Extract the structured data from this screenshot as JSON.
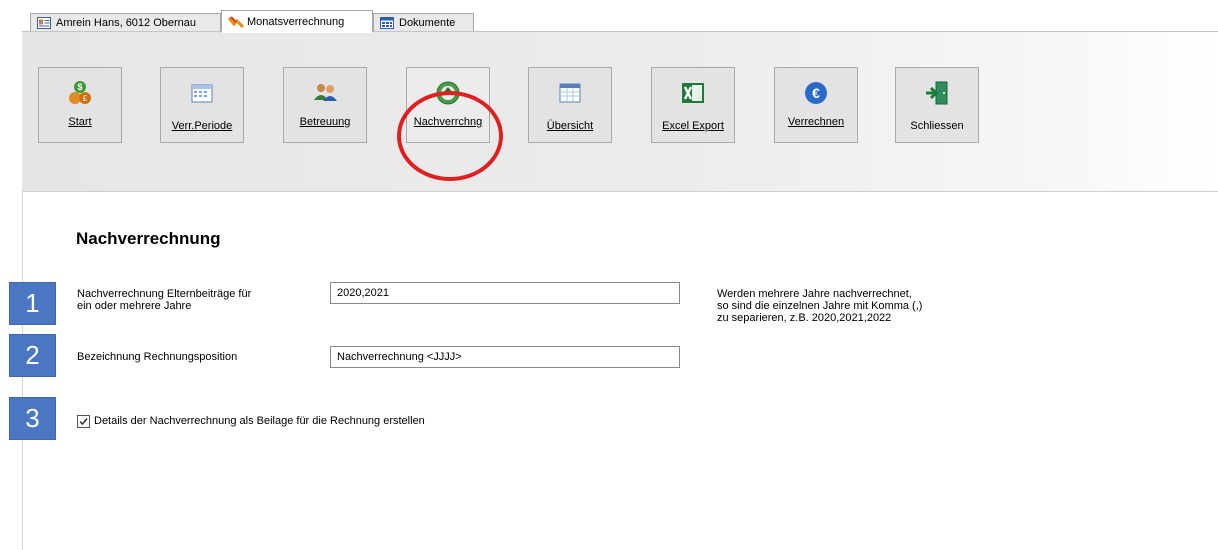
{
  "tabs": [
    {
      "label": "Amrein Hans, 6012 Obernau",
      "icon": "contact-card-icon"
    },
    {
      "label": "Monatsverrechnung",
      "icon": "pen-icon",
      "active": true
    },
    {
      "label": "Dokumente",
      "icon": "grid-icon"
    }
  ],
  "toolbar": {
    "start": "Start",
    "verr_periode": "Verr.Periode",
    "betreuung": "Betreuung",
    "nachverrechnung": "Nachverrchng",
    "uebersicht": "Übersicht",
    "excel_export": "Excel Export",
    "verrechnen": "Verrechnen",
    "schliessen": "Schliessen"
  },
  "section": {
    "title": "Nachverrechnung"
  },
  "steps": [
    "1",
    "2",
    "3"
  ],
  "fields": {
    "years_label_line1": "Nachverrechnung Elternbeiträge für",
    "years_label_line2": "ein oder mehrere Jahre",
    "years_value": "2020,2021",
    "position_label": "Bezeichnung Rechnungsposition",
    "position_value": "Nachverrechnung <JJJJ>",
    "details_checkbox_label": "Details der Nachverrechnung als Beilage für die Rechnung erstellen",
    "details_checked": true
  },
  "hint": {
    "line1": "Werden mehrere Jahre nachverrechnet,",
    "line2": "so sind die einzelnen Jahre mit Komma (,)",
    "line3": "zu separieren, z.B. 2020,2021,2022"
  },
  "colors": {
    "badge": "#4a77c4",
    "highlight_circle": "#e02020"
  }
}
